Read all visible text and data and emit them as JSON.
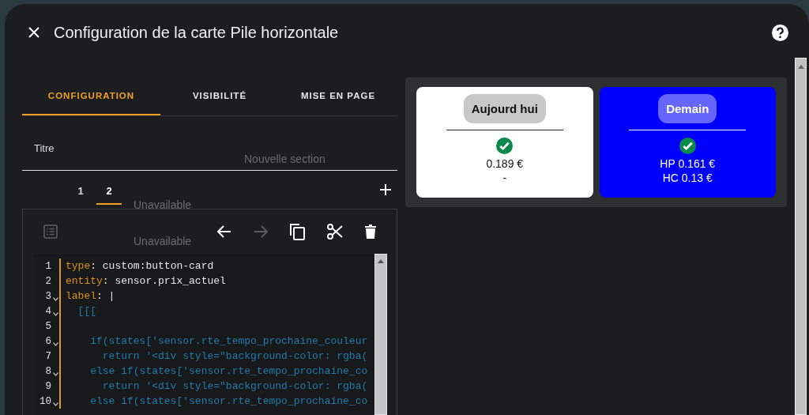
{
  "background_labels": [
    "Nouvelle section",
    "Unavailable",
    "Unavailable"
  ],
  "dialog": {
    "title": "Configuration de la carte Pile horizontale"
  },
  "tabs": [
    {
      "label": "CONFIGURATION",
      "selected": true
    },
    {
      "label": "VISIBILITÉ",
      "selected": false
    },
    {
      "label": "MISE EN PAGE",
      "selected": false
    }
  ],
  "title_field": {
    "placeholder": "Titre"
  },
  "card_tabs": [
    {
      "label": "1",
      "selected": false
    },
    {
      "label": "2",
      "selected": true
    }
  ],
  "editor": {
    "toolbar": [
      {
        "kind": "list",
        "disabled": true
      },
      {
        "kind": "undo",
        "disabled": false
      },
      {
        "kind": "redo",
        "disabled": true
      },
      {
        "kind": "copy",
        "disabled": false
      },
      {
        "kind": "cut",
        "disabled": false
      },
      {
        "kind": "delete",
        "disabled": false
      }
    ],
    "lines": [
      {
        "number": "1",
        "foldable": false,
        "segments": [
          {
            "kind": "key",
            "text": "type"
          },
          {
            "kind": "plain",
            "text": ": custom:button-card"
          }
        ]
      },
      {
        "number": "2",
        "foldable": false,
        "segments": [
          {
            "kind": "key",
            "text": "entity"
          },
          {
            "kind": "plain",
            "text": ": sensor.prix_actuel"
          }
        ]
      },
      {
        "number": "3",
        "foldable": true,
        "segments": [
          {
            "kind": "key",
            "text": "label"
          },
          {
            "kind": "plain",
            "text": ": |"
          }
        ]
      },
      {
        "number": "4",
        "foldable": true,
        "segments": [
          {
            "kind": "template",
            "text": "  [[["
          }
        ]
      },
      {
        "number": "5",
        "foldable": false
      },
      {
        "number": "6",
        "foldable": true,
        "segments": [
          {
            "kind": "template",
            "text": "    if(states['sensor.rte_tempo_prochaine_couleur"
          }
        ]
      },
      {
        "number": "7",
        "foldable": false,
        "segments": [
          {
            "kind": "template",
            "text": "      return '<div style=\"background-color: rgba("
          }
        ]
      },
      {
        "number": "8",
        "foldable": true,
        "segments": [
          {
            "kind": "template",
            "text": "    else if(states['sensor.rte_tempo_prochaine_co"
          }
        ]
      },
      {
        "number": "9",
        "foldable": false,
        "segments": [
          {
            "kind": "template",
            "text": "      return '<div style=\"background-color: rgba("
          }
        ]
      },
      {
        "number": "10",
        "foldable": true,
        "segments": [
          {
            "kind": "template",
            "text": "    else if(states['sensor.rte_tempo_prochaine_co"
          }
        ]
      }
    ]
  },
  "preview": {
    "cards": [
      {
        "title": "Aujourd hui",
        "color": "#ffffff",
        "lines": [
          "0.189 €",
          "-"
        ]
      },
      {
        "title": "Demain",
        "color": "#0000ff",
        "lines": [
          "HP 0.161 €",
          "HC 0.13 €"
        ]
      }
    ]
  }
}
